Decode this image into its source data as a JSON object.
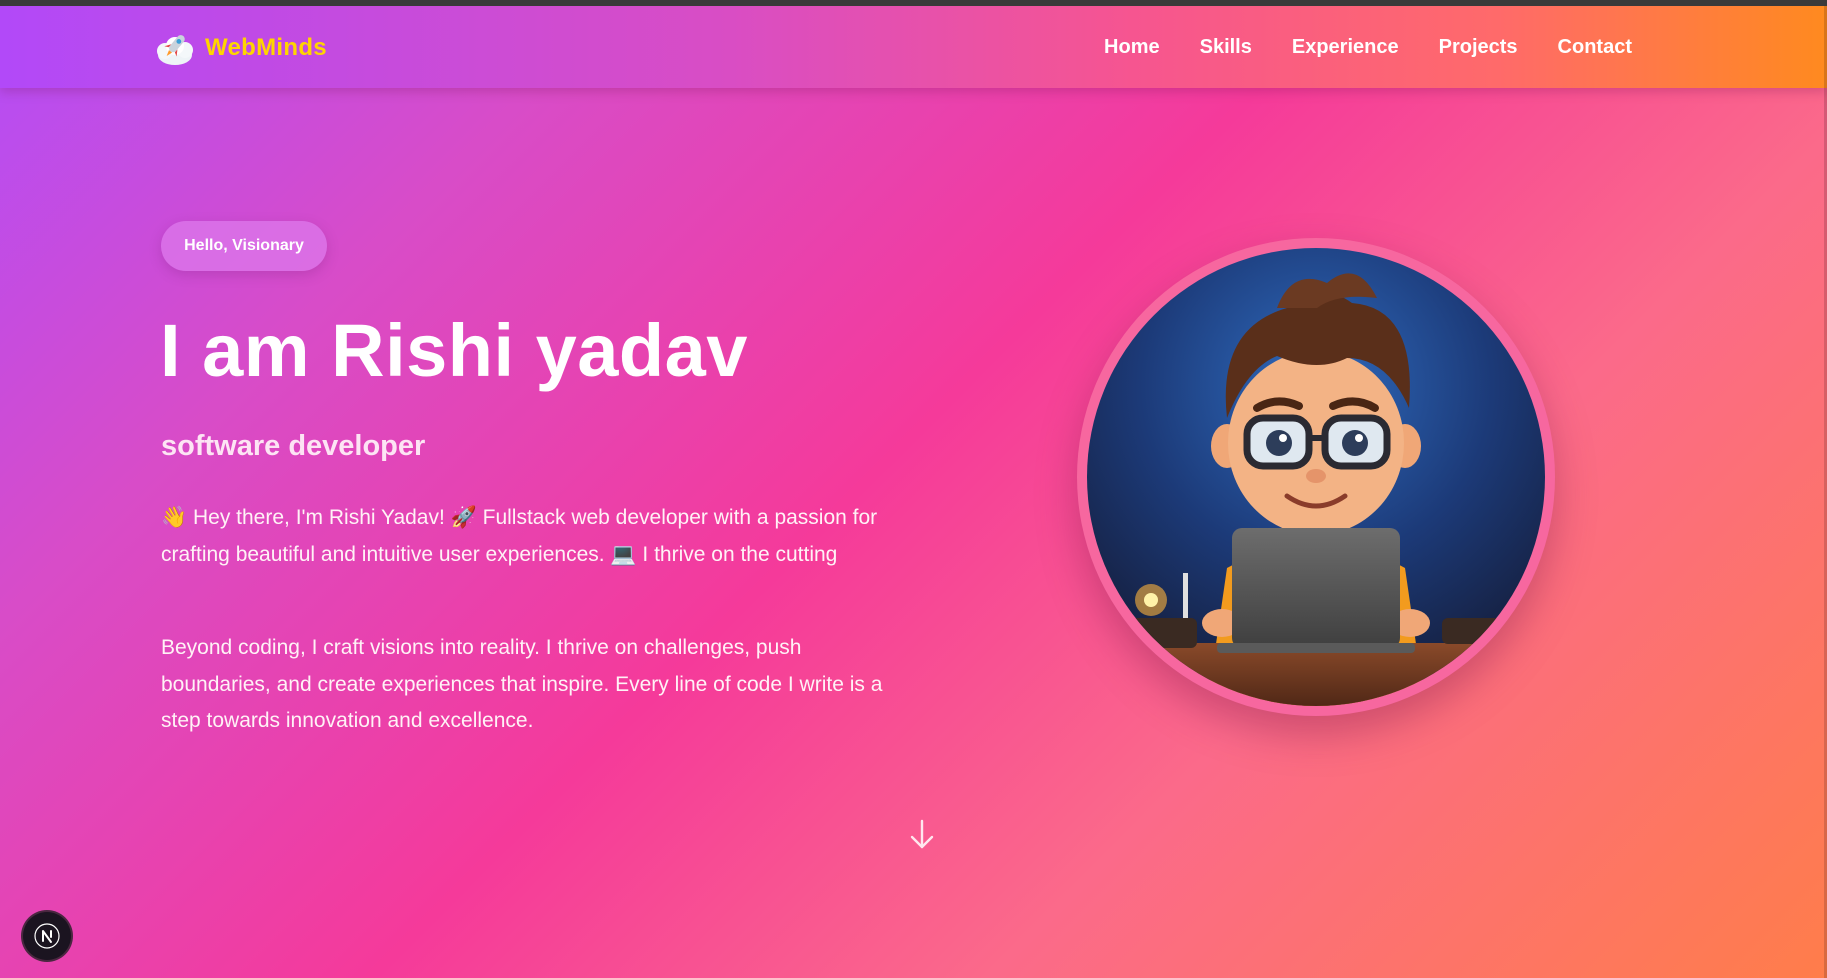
{
  "brand": {
    "name": "WebMinds",
    "logo_icon": "rocket-cloud-icon"
  },
  "nav": {
    "items": [
      {
        "label": "Home"
      },
      {
        "label": "Skills"
      },
      {
        "label": "Experience"
      },
      {
        "label": "Projects"
      },
      {
        "label": "Contact"
      }
    ]
  },
  "hero": {
    "greeting": "Hello, Visionary",
    "title": "I am Rishi yadav",
    "role": "software developer",
    "intro": "👋 Hey there, I'm Rishi Yadav! 🚀 Fullstack web developer with a passion for crafting beautiful and intuitive user experiences. 💻 I thrive on the cutting",
    "about": "Beyond coding, I craft visions into reality. I thrive on challenges, push boundaries, and create experiences that inspire. Every line of code I write is a step towards innovation and excellence."
  },
  "avatar": {
    "icon": "developer-avatar-illustration"
  },
  "scroll": {
    "icon": "arrow-down-icon"
  },
  "dev_badge": {
    "letter": "N",
    "icon": "nextjs-devtools-icon"
  },
  "colors": {
    "brand_yellow": "#ffd400",
    "gradient_start": "#b34df7",
    "gradient_mid": "#f53a9a",
    "gradient_end": "#ff7d4a",
    "avatar_ring": "#f7679f"
  }
}
